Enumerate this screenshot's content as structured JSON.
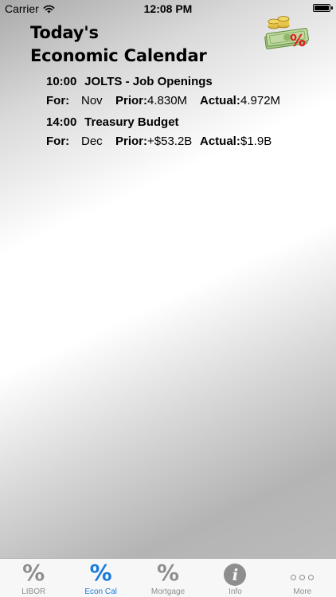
{
  "status_bar": {
    "carrier": "Carrier",
    "time": "12:08 PM",
    "battery_level": 1.0
  },
  "header": {
    "title_line1": "Today's",
    "title_line2": "Economic Calendar",
    "icon": "money-percent-icon"
  },
  "events": [
    {
      "time": "10:00",
      "name": "JOLTS - Job Openings",
      "for_label": "For:",
      "for_value": "Nov",
      "prior_label": "Prior:",
      "prior_value": "4.830M",
      "actual_label": "Actual:",
      "actual_value": "4.972M"
    },
    {
      "time": "14:00",
      "name": "Treasury Budget",
      "for_label": "For:",
      "for_value": "Dec",
      "prior_label": "Prior:",
      "prior_value": "+$53.2B",
      "actual_label": "Actual:",
      "actual_value": "$1.9B"
    }
  ],
  "tab_bar": {
    "active_color": "#1a7bd9",
    "inactive_color": "#8e8e8e",
    "tabs": [
      {
        "label": "LIBOR",
        "icon": "percent-icon",
        "active": false
      },
      {
        "label": "Econ Cal",
        "icon": "percent-icon",
        "active": true
      },
      {
        "label": "Mortgage",
        "icon": "percent-icon",
        "active": false
      },
      {
        "label": "Info",
        "icon": "info-icon",
        "active": false
      },
      {
        "label": "More",
        "icon": "more-icon",
        "active": false
      }
    ]
  },
  "glyphs": {
    "percent": "%",
    "info": "i"
  }
}
